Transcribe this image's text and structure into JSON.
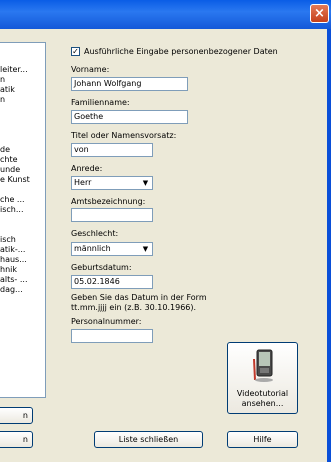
{
  "window": {
    "close_glyph": "×"
  },
  "left_list": {
    "items": [
      "leiter...",
      "n",
      "atik",
      "n",
      "",
      "",
      "",
      "",
      "de",
      "chte",
      "unde",
      "e Kunst",
      "",
      "che ...",
      "isch...",
      "",
      "",
      "isch",
      "atik-...",
      "haus...",
      "hnik",
      "alts- ...",
      "dag..."
    ]
  },
  "left_buttons": {
    "top": "n",
    "bottom": "n"
  },
  "form": {
    "checkbox_label": "Ausführliche Eingabe personenbezogener Daten",
    "checkbox_checked": true,
    "vorname_label": "Vorname:",
    "vorname_value": "Johann Wolfgang",
    "familienname_label": "Familienname:",
    "familienname_value": "Goethe",
    "titel_label": "Titel oder Namensvorsatz:",
    "titel_value": "von",
    "anrede_label": "Anrede:",
    "anrede_value": "Herr",
    "amts_label": "Amtsbezeichnung:",
    "amts_value": "",
    "geschlecht_label": "Geschlecht:",
    "geschlecht_value": "männlich",
    "geburtsdatum_label": "Geburtsdatum:",
    "geburtsdatum_value": "05.02.1846",
    "hint_line1": "Geben Sie das Datum in der Form",
    "hint_line2": "tt.mm.jjjj ein (z.B.  30.10.1966).",
    "personalnummer_label": "Personalnummer:",
    "personalnummer_value": ""
  },
  "video_button": {
    "line1": "Videotutorial",
    "line2": "ansehen...",
    "icon": "pda-with-pen-icon"
  },
  "footer": {
    "close_list": "Liste schließen",
    "help": "Hilfe"
  }
}
